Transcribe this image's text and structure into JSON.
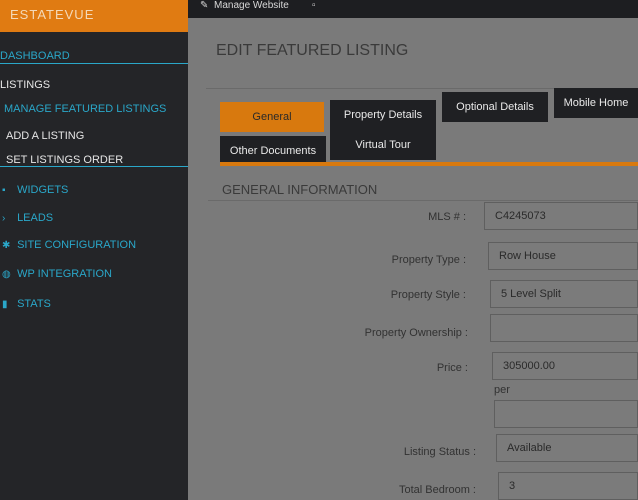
{
  "brand": {
    "logo_text": "ESTATEVUE"
  },
  "topbar": {
    "manage_website": "Manage Website"
  },
  "sidebar": {
    "items": [
      {
        "label": "DASHBOARD"
      },
      {
        "label": "LISTINGS"
      },
      {
        "label": "MANAGE FEATURED LISTINGS"
      },
      {
        "label": "ADD A LISTING"
      },
      {
        "label": "SET LISTINGS ORDER"
      },
      {
        "label": "WIDGETS"
      },
      {
        "label": "LEADS"
      },
      {
        "label": "SITE CONFIGURATION"
      },
      {
        "label": "WP INTEGRATION"
      },
      {
        "label": "STATS"
      }
    ]
  },
  "main": {
    "title": "EDIT FEATURED LISTING",
    "tabs": [
      {
        "label": "General"
      },
      {
        "label": "Property Details"
      },
      {
        "label": "Optional Details"
      },
      {
        "label": "Mobile Home"
      },
      {
        "label": "Other Documents"
      },
      {
        "label": "Virtual Tour"
      }
    ],
    "section_title": "GENERAL INFORMATION",
    "form": {
      "mls_label": "MLS # :",
      "mls_value": "C4245073",
      "property_type_label": "Property Type :",
      "property_type_value": "Row House",
      "property_style_label": "Property Style :",
      "property_style_value": "5 Level Split",
      "property_ownership_label": "Property Ownership :",
      "property_ownership_value": "",
      "price_label": "Price :",
      "price_value": "305000.00",
      "per_label": "per",
      "per_value": "",
      "listing_status_label": "Listing Status :",
      "listing_status_value": "Available",
      "total_bedroom_label": "Total Bedroom :",
      "total_bedroom_value": "3"
    }
  },
  "colors": {
    "accent": "#e07b12",
    "sidebar_bg": "#242528",
    "link": "#2aa7c9",
    "content_bg": "#7a7a7a"
  }
}
